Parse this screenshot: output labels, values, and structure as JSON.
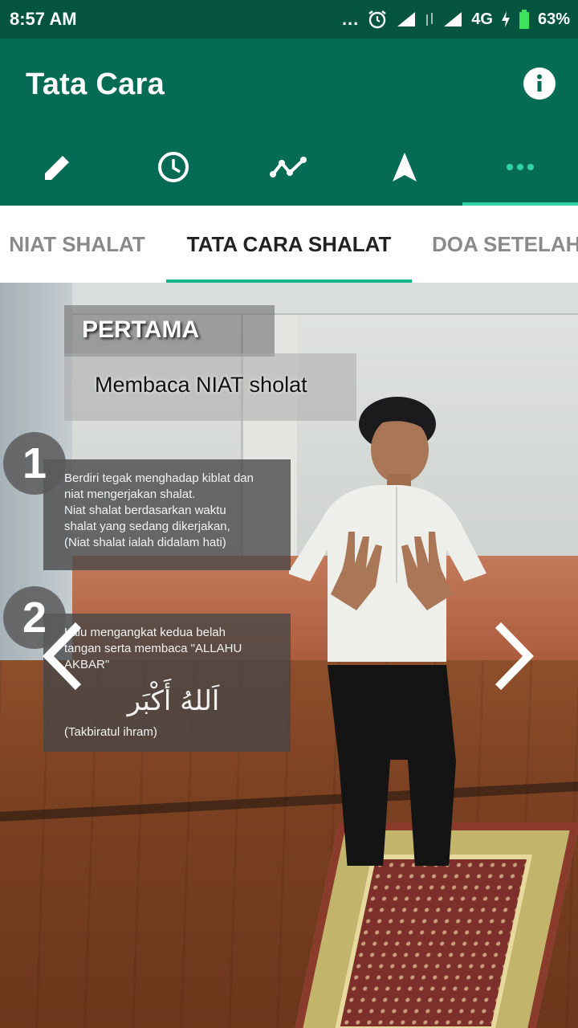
{
  "status_bar": {
    "time": "8:57 AM",
    "dots": "...",
    "network": "4G",
    "battery": "63%",
    "icons": [
      "alarm-icon",
      "signal-icon",
      "signal-icon",
      "charging-icon",
      "battery-icon"
    ]
  },
  "app_bar": {
    "title": "Tata Cara",
    "info_icon": "info-icon"
  },
  "icon_tabs": [
    {
      "icon": "pencil-icon",
      "active": false
    },
    {
      "icon": "clock-icon",
      "active": false
    },
    {
      "icon": "trend-icon",
      "active": false
    },
    {
      "icon": "navigation-icon",
      "active": false
    },
    {
      "icon": "more-dots-icon",
      "active": true
    }
  ],
  "text_tabs": [
    {
      "label": "NIAT SHALAT",
      "active": false
    },
    {
      "label": "TATA CARA SHALAT",
      "active": true
    },
    {
      "label": "DOA SETELAH",
      "active": false
    }
  ],
  "content": {
    "title": "PERTAMA",
    "subtitle": "Membaca NIAT sholat",
    "step1": {
      "number": "1",
      "lines": [
        "Berdiri tegak menghadap kiblat dan",
        "niat mengerjakan shalat.",
        "Niat shalat berdasarkan waktu",
        "shalat yang sedang dikerjakan,",
        "(Niat shalat ialah didalam hati)"
      ]
    },
    "step2": {
      "number": "2",
      "lines": [
        "Lalu mengangkat kedua belah",
        "tangan serta membaca \"ALLAHU",
        "AKBAR\""
      ],
      "arabic": "اَللهُ أَكْبَر",
      "note": "(Takbiratul ihram)"
    },
    "prev_icon": "chevron-left-icon",
    "next_icon": "chevron-right-icon"
  },
  "colors": {
    "status_bar": "#05543f",
    "app_bar": "#066b55",
    "accent": "#2fd3a6",
    "tab_indicator": "#17b58a"
  }
}
